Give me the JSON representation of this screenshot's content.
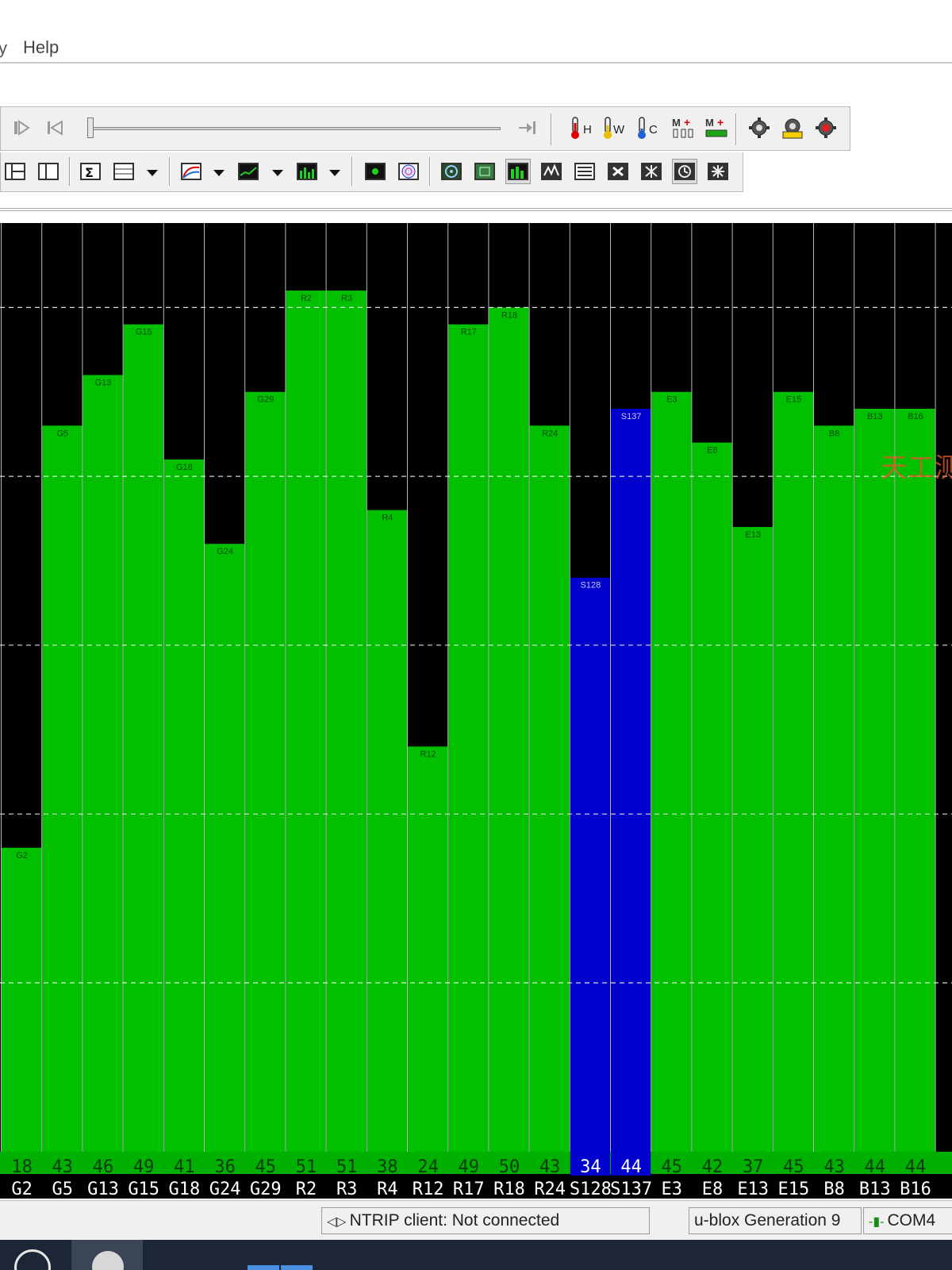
{
  "menu": {
    "fragment": "y",
    "help_label": "Help"
  },
  "toolbar": {
    "row1_icons": [
      "play-step-icon",
      "skip-to-start-icon",
      "skip-to-end-icon",
      "thermometer-h-icon",
      "thermometer-w-icon",
      "thermometer-c-icon",
      "message-add-icon",
      "message-add-green-icon",
      "receiver-config-icon",
      "receiver-config-yellow-icon",
      "receiver-config-red-icon"
    ],
    "row1_labels": {
      "hot": "H",
      "warm": "W",
      "cold": "C"
    },
    "row2_icons": [
      "docking-view-icon",
      "split-view-icon",
      "statistics-view-icon",
      "table-view-icon",
      "map-view-icon",
      "chart-view-icon",
      "histogram-view-icon",
      "camera-view-icon",
      "sky-view-icon",
      "deviation-map-icon",
      "grid-map-icon",
      "signal-chart-icon",
      "spectrum-icon",
      "text-console-icon",
      "message-view-icon",
      "packet-console-icon",
      "binary-console-icon",
      "compass-view-icon"
    ]
  },
  "colors": {
    "used_gnss": "#00c000",
    "sbas": "#0000cc",
    "unused": "#000000",
    "grid": "#ffffff",
    "watermark": "#e05a2a"
  },
  "chart_data": {
    "type": "bar",
    "categories": [
      "G2",
      "G5",
      "G13",
      "G15",
      "G18",
      "G24",
      "G29",
      "R2",
      "R3",
      "R4",
      "R12",
      "R17",
      "R18",
      "R24",
      "S128",
      "S137",
      "E3",
      "E8",
      "E13",
      "E15",
      "B8",
      "B13",
      "B16"
    ],
    "values": [
      18,
      43,
      46,
      49,
      41,
      36,
      45,
      51,
      51,
      38,
      24,
      49,
      50,
      43,
      34,
      44,
      45,
      42,
      37,
      45,
      43,
      44,
      44
    ],
    "bar_colors": [
      "green",
      "green",
      "green",
      "green",
      "green",
      "green",
      "green",
      "green",
      "green",
      "green",
      "green",
      "green",
      "green",
      "green",
      "blue",
      "blue",
      "green",
      "green",
      "green",
      "green",
      "green",
      "green",
      "green"
    ],
    "ylim": [
      0,
      55
    ],
    "grid": true,
    "watermark": "天工测"
  },
  "status": {
    "ntrip": "NTRIP client: Not connected",
    "receiver": "u-blox Generation 9",
    "port": "COM4"
  }
}
